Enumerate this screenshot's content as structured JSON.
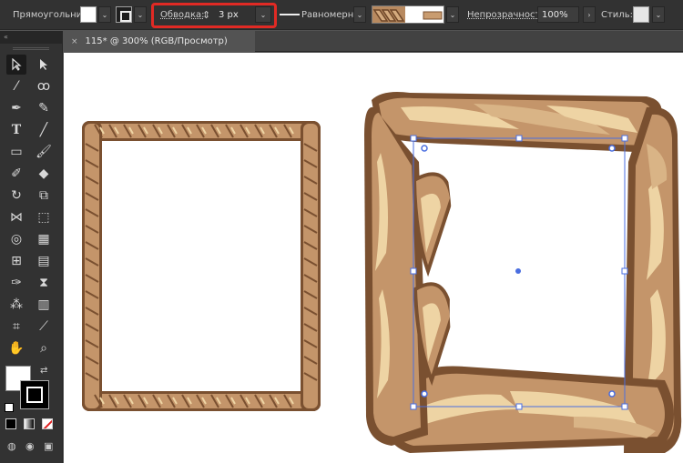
{
  "control_bar": {
    "object_type": "Прямоугольник",
    "stroke_label": "Обводка:",
    "stroke_value": "3 px",
    "profile_label": "Равномерно",
    "opacity_label": "Непрозрачность:",
    "opacity_value": "100%",
    "style_label": "Стиль:",
    "highlight_color": "#e12a24"
  },
  "document_tab": {
    "title": "115* @ 300% (RGB/Просмотр)",
    "close": "×"
  },
  "tools_panel": {
    "collapse": "«",
    "tools": [
      "selection-tool",
      "direct-selection-tool",
      "magic-wand-tool",
      "lasso-tool",
      "pen-tool",
      "curvature-tool",
      "type-tool",
      "line-segment-tool",
      "rectangle-tool",
      "paintbrush-tool",
      "shaper-tool",
      "eraser-tool",
      "rotate-tool",
      "scale-tool",
      "width-tool",
      "free-transform-tool",
      "shape-builder-tool",
      "perspective-grid-tool",
      "mesh-tool",
      "gradient-tool",
      "eyedropper-tool",
      "blend-tool",
      "symbol-sprayer-tool",
      "column-graph-tool",
      "artboard-tool",
      "slice-tool",
      "hand-tool",
      "zoom-tool"
    ]
  },
  "colors": {
    "rope_dark": "#7a5030",
    "rope_mid": "#c4956a",
    "rope_light": "#eed4a4",
    "selection": "#4a6ee0"
  }
}
